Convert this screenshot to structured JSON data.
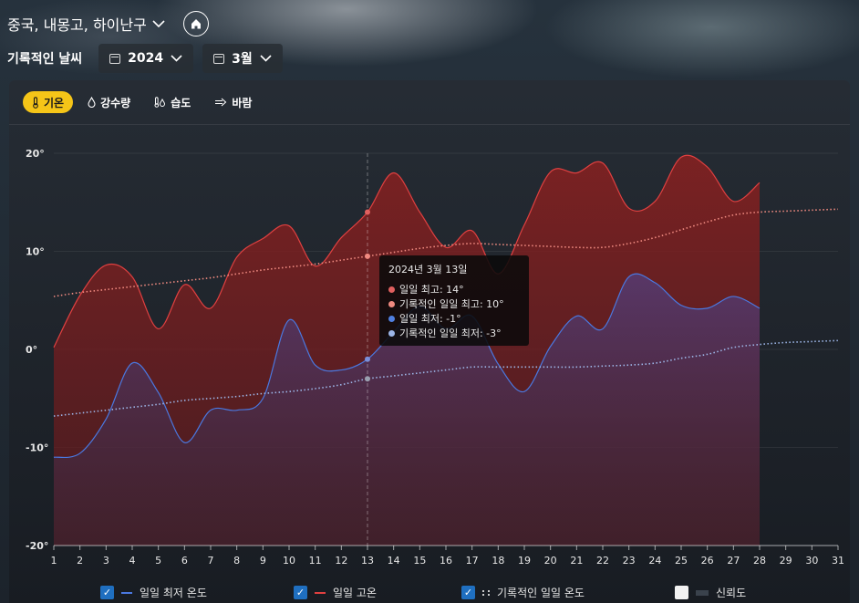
{
  "location": {
    "label": "중국, 내몽고, 하이난구",
    "chevron_icon": "chevron-down-icon",
    "home_icon": "home-icon"
  },
  "history": {
    "title": "기록적인 날씨",
    "year": "2024",
    "month": "3월"
  },
  "tabs": [
    {
      "label": "기온",
      "icon": "thermometer-icon",
      "active": true
    },
    {
      "label": "강수량",
      "icon": "droplet-icon",
      "active": false
    },
    {
      "label": "습도",
      "icon": "humidity-icon",
      "active": false
    },
    {
      "label": "바람",
      "icon": "wind-icon",
      "active": false
    }
  ],
  "tooltip": {
    "title": "2024년 3월 13일",
    "rows": [
      {
        "label": "일일 최고: 14°",
        "color": "#e0605f"
      },
      {
        "label": "기록적인 일일 최고: 10°",
        "color": "#f08a80"
      },
      {
        "label": "일일 최저: -1°",
        "color": "#4f7fe0"
      },
      {
        "label": "기록적인 일일 최저: -3°",
        "color": "#9db6e8"
      }
    ]
  },
  "legend": [
    {
      "label": "일일 최저 온도",
      "checked": true,
      "color": "#4a78e0",
      "style": "line"
    },
    {
      "label": "일일 고온",
      "checked": true,
      "color": "#e04040",
      "style": "line"
    },
    {
      "label": "기록적인 일일 온도",
      "checked": true,
      "color": "#cccccc",
      "style": "dotted"
    },
    {
      "label": "신뢰도",
      "checked": false,
      "color": "#3a424c",
      "style": "band"
    }
  ],
  "chart_data": {
    "type": "area",
    "x": [
      1,
      2,
      3,
      4,
      5,
      6,
      7,
      8,
      9,
      10,
      11,
      12,
      13,
      14,
      15,
      16,
      17,
      18,
      19,
      20,
      21,
      22,
      23,
      24,
      25,
      26,
      27,
      28,
      29,
      30,
      31
    ],
    "xlim": [
      1,
      31
    ],
    "ylim": [
      -20,
      20
    ],
    "yticks": [
      -20,
      -10,
      0,
      10,
      20
    ],
    "ytick_labels": [
      "-20°",
      "-10°",
      "0°",
      "10°",
      "20°"
    ],
    "highlight_x": 13,
    "series": [
      {
        "name": "일일 고온",
        "color": "#e04040",
        "x": [
          1,
          2,
          3,
          4,
          5,
          6,
          7,
          8,
          9,
          10,
          11,
          12,
          13,
          14,
          15,
          16,
          17,
          18,
          19,
          20,
          21,
          22,
          23,
          24,
          25,
          26,
          27,
          28
        ],
        "values": [
          0.2,
          5.5,
          8.6,
          7.4,
          2.1,
          6.6,
          4.2,
          9.4,
          11.3,
          12.6,
          8.5,
          11.4,
          14,
          18,
          14,
          10.4,
          12.1,
          7.7,
          12.7,
          18.1,
          18,
          19,
          14.4,
          15.1,
          19.6,
          18.6,
          15.1,
          17
        ]
      },
      {
        "name": "일일 최저 온도",
        "color": "#4a78e0",
        "x": [
          1,
          2,
          3,
          4,
          5,
          6,
          7,
          8,
          9,
          10,
          11,
          12,
          13,
          14,
          15,
          16,
          17,
          18,
          19,
          20,
          21,
          22,
          23,
          24,
          25,
          26,
          27,
          28
        ],
        "values": [
          -11,
          -10.6,
          -7.1,
          -1.4,
          -4.4,
          -9.5,
          -6.2,
          -6.2,
          -5,
          3,
          -1.6,
          -2.1,
          -1,
          1.8,
          4.4,
          2.1,
          3.4,
          -1.5,
          -4.3,
          0.3,
          3.4,
          2.1,
          7.4,
          6.8,
          4.5,
          4.2,
          5.4,
          4.2
        ]
      },
      {
        "name": "기록적인 일일 최고",
        "color": "#f08a80",
        "style": "dotted",
        "x": [
          1,
          2,
          3,
          4,
          5,
          6,
          7,
          8,
          9,
          10,
          11,
          12,
          13,
          14,
          15,
          16,
          17,
          18,
          19,
          20,
          21,
          22,
          23,
          24,
          25,
          26,
          27,
          28,
          29,
          30,
          31
        ],
        "values": [
          5.4,
          5.8,
          6.1,
          6.4,
          6.7,
          7,
          7.3,
          7.7,
          8.1,
          8.4,
          8.7,
          9.1,
          9.5,
          9.9,
          10.3,
          10.6,
          10.8,
          10.7,
          10.6,
          10.5,
          10.4,
          10.4,
          10.8,
          11.4,
          12.2,
          13,
          13.7,
          14,
          14.1,
          14.2,
          14.3
        ]
      },
      {
        "name": "기록적인 일일 최저",
        "color": "#9db6e8",
        "style": "dotted",
        "x": [
          1,
          2,
          3,
          4,
          5,
          6,
          7,
          8,
          9,
          10,
          11,
          12,
          13,
          14,
          15,
          16,
          17,
          18,
          19,
          20,
          21,
          22,
          23,
          24,
          25,
          26,
          27,
          28,
          29,
          30,
          31
        ],
        "values": [
          -6.8,
          -6.5,
          -6.2,
          -5.9,
          -5.6,
          -5.2,
          -5,
          -4.8,
          -4.5,
          -4.3,
          -4,
          -3.6,
          -3,
          -2.7,
          -2.4,
          -2.1,
          -1.8,
          -1.8,
          -1.8,
          -1.8,
          -1.8,
          -1.7,
          -1.6,
          -1.4,
          -0.9,
          -0.5,
          0.2,
          0.5,
          0.7,
          0.8,
          0.9
        ]
      }
    ]
  }
}
